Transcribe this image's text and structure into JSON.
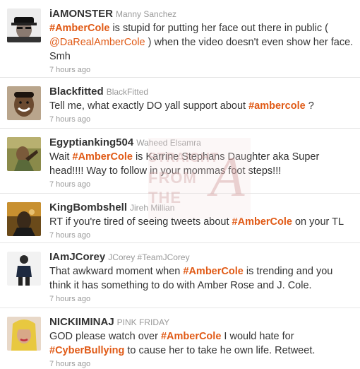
{
  "tweets": [
    {
      "handle": "iAMONSTER",
      "name": "Manny Sanchez",
      "segments": [
        {
          "t": "hash",
          "v": "#AmberCole"
        },
        {
          "t": "text",
          "v": " is stupid for putting her face out there in public ( "
        },
        {
          "t": "mention",
          "v": "@DaRealAmberCole"
        },
        {
          "t": "text",
          "v": " ) when the video doesn't even show her face. Smh"
        }
      ],
      "time": "7 hours ago",
      "avatar_icon": "person-hat-icon"
    },
    {
      "handle": "Blackfitted",
      "name": "BlackFitted",
      "segments": [
        {
          "t": "text",
          "v": "Tell me, what exactly DO yall support about "
        },
        {
          "t": "hash",
          "v": "#ambercole"
        },
        {
          "t": "text",
          "v": " ?"
        }
      ],
      "time": "7 hours ago",
      "avatar_icon": "person-smiling-icon"
    },
    {
      "handle": "Egyptianking504",
      "name": "Waheed Elsamra",
      "segments": [
        {
          "t": "text",
          "v": "Wait "
        },
        {
          "t": "hash",
          "v": "#AmberCole"
        },
        {
          "t": "text",
          "v": " is Karrine Stephans Daughter aka Super head!!!! Way to follow in your mommas foot steps!!!"
        }
      ],
      "time": "7 hours ago",
      "avatar_icon": "person-outdoor-icon"
    },
    {
      "handle": "KingBombshell",
      "name": "Jireh Millian",
      "segments": [
        {
          "t": "text",
          "v": "RT if you're tired of seeing tweets about "
        },
        {
          "t": "hash",
          "v": "#AmberCole"
        },
        {
          "t": "text",
          "v": " on your TL"
        }
      ],
      "time": "7 hours ago",
      "avatar_icon": "person-dark-icon"
    },
    {
      "handle": "IAmJCorey",
      "name": "JCorey #TeamJCorey",
      "segments": [
        {
          "t": "text",
          "v": "That awkward moment when "
        },
        {
          "t": "hash",
          "v": "#AmberCole"
        },
        {
          "t": "text",
          "v": " is trending and you think it has something to do with Amber Rose and J. Cole."
        }
      ],
      "time": "7 hours ago",
      "avatar_icon": "person-standing-icon"
    },
    {
      "handle": "NICKIIMINAJ",
      "name": "PINK FRIDAY",
      "segments": [
        {
          "t": "text",
          "v": "GOD please watch over "
        },
        {
          "t": "hash",
          "v": "#AmberCole"
        },
        {
          "t": "text",
          "v": " I would hate for "
        },
        {
          "t": "hash",
          "v": "#CyberBullying"
        },
        {
          "t": "text",
          "v": " to cause her to take he own life. Retweet."
        }
      ],
      "time": "7 hours ago",
      "avatar_icon": "person-blonde-icon"
    }
  ],
  "watermark": {
    "lines": [
      "STRAIGHT",
      "FROM",
      "THE"
    ],
    "logo_letter": "A"
  },
  "colors": {
    "hashtag": "#e05a16",
    "handle": "#333333",
    "muted": "#999999"
  }
}
